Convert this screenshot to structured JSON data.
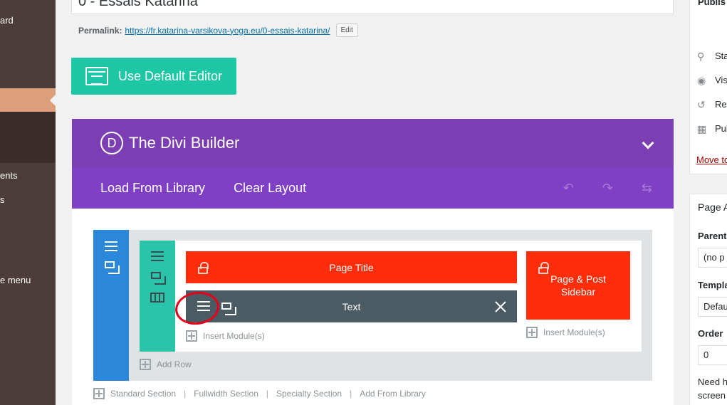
{
  "admin_menu": {
    "items": [
      {
        "label": "ard"
      },
      {
        "label": "ents"
      },
      {
        "label": "s"
      },
      {
        "label": "e menu"
      }
    ]
  },
  "post": {
    "title": "0 - Essais Katarina",
    "permalink_label": "Permalink:",
    "permalink_url": "https://fr.katarina-varsikova-yoga.eu/0-essais-katarina/",
    "edit_label": "Edit"
  },
  "default_editor_label": "Use Default Editor",
  "divi": {
    "logo_letter": "D",
    "title": "The Divi Builder",
    "toolbar": {
      "load_label": "Load From Library",
      "clear_label": "Clear Layout"
    },
    "modules": {
      "page_title": "Page Title",
      "text": "Text",
      "sidebar": "Page & Post Sidebar"
    },
    "insert_module_label": "Insert Module(s)",
    "add_row_label": "Add Row",
    "footer_links": [
      "Standard Section",
      "Fullwidth Section",
      "Specialty Section",
      "Add From Library"
    ]
  },
  "publish": {
    "title": "Publis",
    "status": "Sta",
    "visibility": "Visi",
    "revisions": "Rev",
    "published": "Pub",
    "move_trash": "Move to"
  },
  "attributes": {
    "title": "Page A",
    "parent_label": "Parent",
    "parent_value": "(no p",
    "template_label": "Templa",
    "template_value": "Defau",
    "order_label": "Order",
    "order_value": "0",
    "help_line1": "Need h",
    "help_line2": "screen"
  },
  "colors": {
    "admin_menu_bg": "#4d3d3a",
    "admin_active": "#dd9f79",
    "divi_header": "#7c3eb3",
    "divi_toolbar": "#8040c6",
    "section_handle": "#2b87da",
    "row_handle": "#29c4a9",
    "module_red": "#ff2d0a",
    "module_dark": "#4b5b63",
    "default_editor": "#1dc6a5",
    "annotation_circle": "#e8001a"
  }
}
